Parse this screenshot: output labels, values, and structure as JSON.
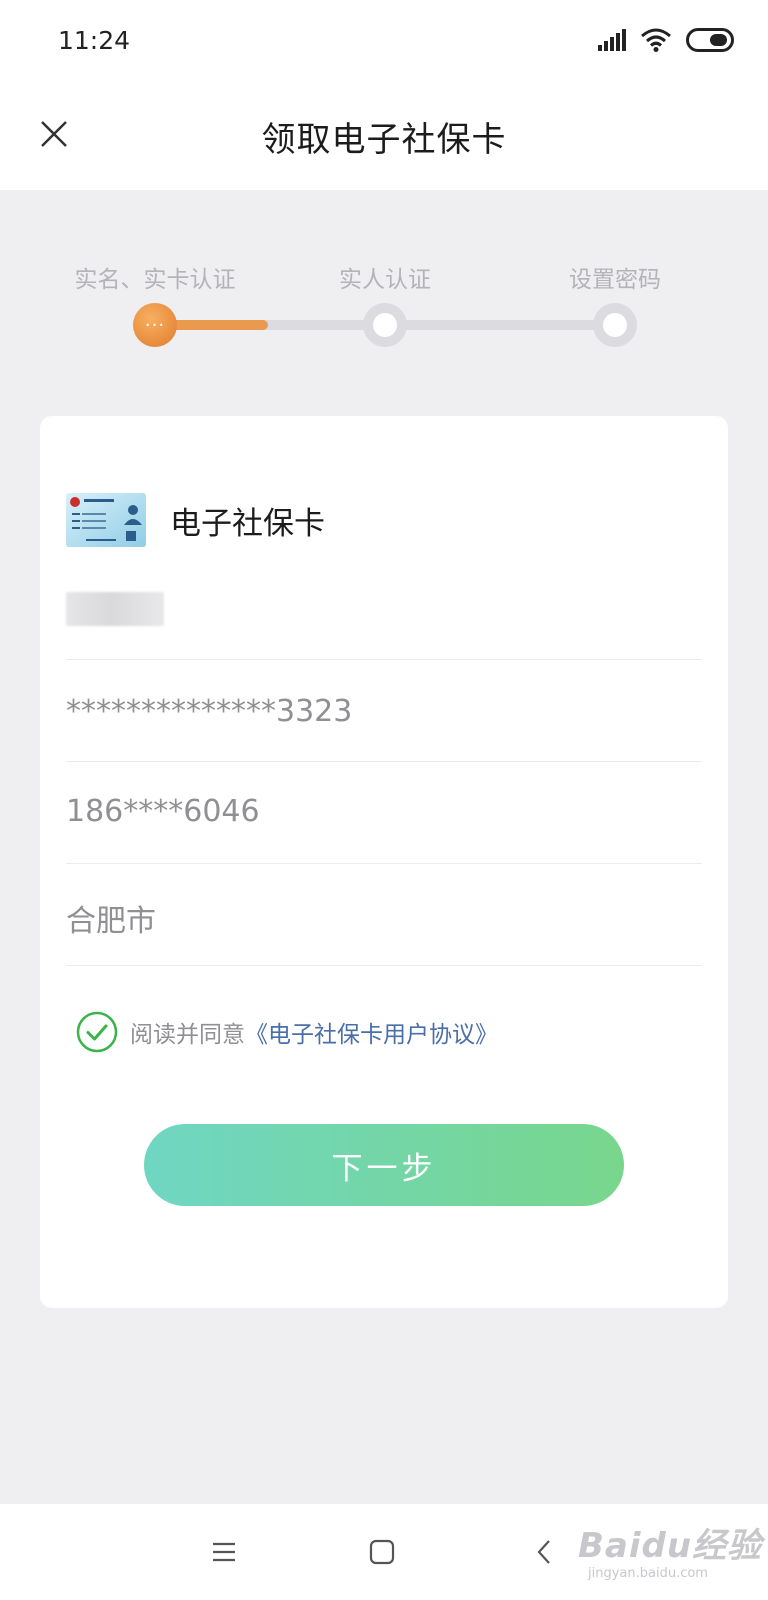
{
  "status_bar": {
    "time": "11:24"
  },
  "header": {
    "title": "领取电子社保卡"
  },
  "steps": [
    {
      "label": "实名、实卡认证",
      "state": "active"
    },
    {
      "label": "实人认证",
      "state": "pending"
    },
    {
      "label": "设置密码",
      "state": "pending"
    }
  ],
  "step_progress": 0.3,
  "card": {
    "title": "电子社保卡",
    "id_number": "**************3323",
    "phone": "186****6046",
    "city": "合肥市",
    "agreement_prefix": "阅读并同意",
    "agreement_link": "《电子社保卡用户协议》",
    "agreement_checked": true,
    "next_button": "下一步"
  },
  "colors": {
    "accent_orange": "#e99a4f",
    "button_start": "#6fd6c3",
    "button_end": "#78d68c",
    "link": "#4a6fa8",
    "check_green": "#3bb34a"
  },
  "watermark": {
    "logo_text": "Baidu经验",
    "url_text": "jingyan.baidu.com"
  }
}
